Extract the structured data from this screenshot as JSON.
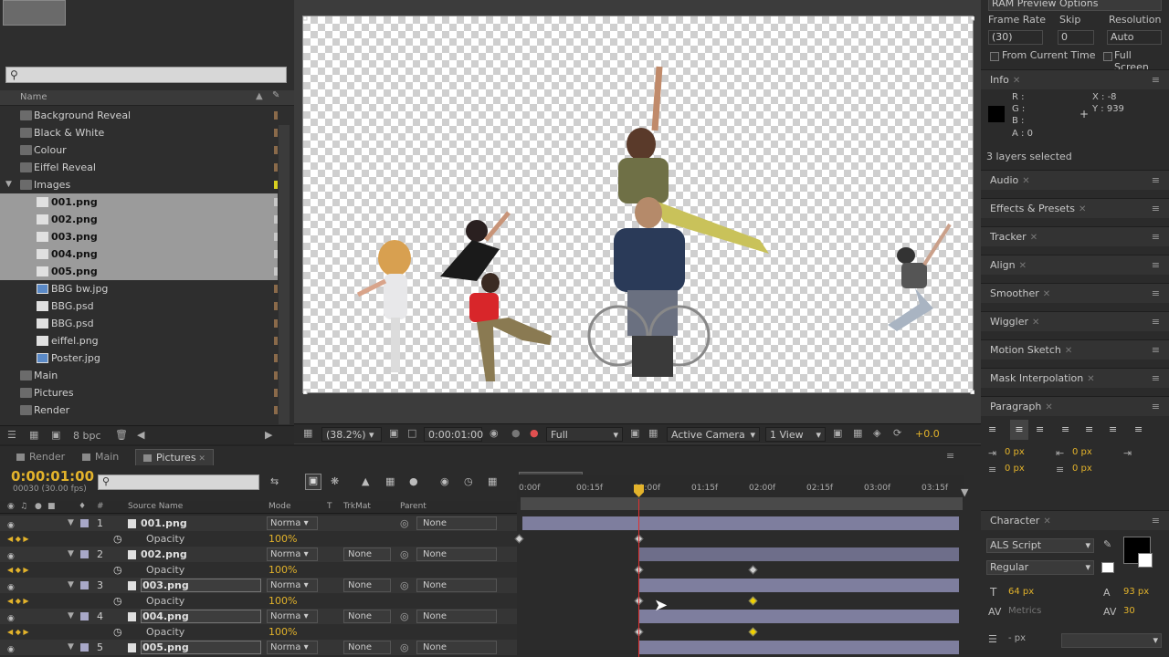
{
  "project": {
    "search_placeholder": "",
    "column_name": "Name",
    "items": [
      {
        "label": "Background Reveal",
        "type": "comp",
        "selected": false,
        "indent": 0
      },
      {
        "label": "Black & White",
        "type": "comp",
        "selected": false,
        "indent": 0
      },
      {
        "label": "Colour",
        "type": "comp",
        "selected": false,
        "indent": 0
      },
      {
        "label": "Eiffel Reveal",
        "type": "comp",
        "selected": false,
        "indent": 0
      },
      {
        "label": "Images",
        "type": "folder",
        "selected": false,
        "indent": 0
      },
      {
        "label": "001.png",
        "type": "file",
        "selected": true,
        "indent": 1
      },
      {
        "label": "002.png",
        "type": "file",
        "selected": true,
        "indent": 1
      },
      {
        "label": "003.png",
        "type": "file",
        "selected": true,
        "indent": 1
      },
      {
        "label": "004.png",
        "type": "file",
        "selected": true,
        "indent": 1
      },
      {
        "label": "005.png",
        "type": "file",
        "selected": true,
        "indent": 1
      },
      {
        "label": "BBG bw.jpg",
        "type": "image",
        "selected": false,
        "indent": 1
      },
      {
        "label": "BBG.psd",
        "type": "file",
        "selected": false,
        "indent": 1
      },
      {
        "label": "BBG.psd",
        "type": "file",
        "selected": false,
        "indent": 1
      },
      {
        "label": "eiffel.png",
        "type": "file",
        "selected": false,
        "indent": 1
      },
      {
        "label": "Poster.jpg",
        "type": "image",
        "selected": false,
        "indent": 1
      },
      {
        "label": "Main",
        "type": "comp",
        "selected": false,
        "indent": 0
      },
      {
        "label": "Pictures",
        "type": "comp",
        "selected": false,
        "indent": 0
      },
      {
        "label": "Render",
        "type": "comp",
        "selected": false,
        "indent": 0
      }
    ],
    "bpc": "8 bpc"
  },
  "viewer": {
    "zoom": "(38.2%)",
    "timecode": "0:00:01:00",
    "resolution": "Full",
    "camera": "Active Camera",
    "views": "1 View",
    "exposure": "+0.0"
  },
  "preview": {
    "title": "RAM Preview Options",
    "frame_rate_label": "Frame Rate",
    "frame_rate_value": "(30)",
    "skip_label": "Skip",
    "skip_value": "0",
    "resolution_label": "Resolution",
    "resolution_value": "Auto",
    "from_current": "From Current Time",
    "full_screen": "Full Screen"
  },
  "info": {
    "title": "Info",
    "r": "R :",
    "g": "G :",
    "b": "B :",
    "a": "A : 0",
    "x": "X : -8",
    "y": "Y : 939",
    "status": "3 layers selected"
  },
  "panels": [
    {
      "label": "Audio"
    },
    {
      "label": "Effects & Presets"
    },
    {
      "label": "Tracker"
    },
    {
      "label": "Align"
    },
    {
      "label": "Smoother"
    },
    {
      "label": "Wiggler"
    },
    {
      "label": "Motion Sketch"
    },
    {
      "label": "Mask Interpolation"
    },
    {
      "label": "Paragraph"
    }
  ],
  "paragraph": {
    "indent1": "0 px",
    "indent2": "0 px",
    "indent3": "0 px",
    "indent4": "0 px"
  },
  "character": {
    "title": "Character",
    "font": "ALS Script",
    "style": "Regular",
    "size": "64 px",
    "leading": "93 px",
    "kerning": "Metrics",
    "tracking": "30",
    "stroke": "- px"
  },
  "timeline": {
    "tabs": [
      {
        "label": "Render",
        "active": false
      },
      {
        "label": "Main",
        "active": false
      },
      {
        "label": "Pictures",
        "active": true
      }
    ],
    "timecode": "0:00:01:00",
    "timecode_sub": "00030 (30.00 fps)",
    "headers": {
      "source": "Source Name",
      "mode": "Mode",
      "t": "T",
      "trkmat": "TrkMat",
      "parent": "Parent"
    },
    "rows": [
      {
        "kind": "layer",
        "num": "1",
        "name": "001.png",
        "mode": "Norma",
        "trkmat": "",
        "parent": "None",
        "boxed": false
      },
      {
        "kind": "sub",
        "prop": "Opacity",
        "value": "100%"
      },
      {
        "kind": "layer",
        "num": "2",
        "name": "002.png",
        "mode": "Norma",
        "trkmat": "None",
        "parent": "None",
        "boxed": false
      },
      {
        "kind": "sub",
        "prop": "Opacity",
        "value": "100%"
      },
      {
        "kind": "layer",
        "num": "3",
        "name": "003.png",
        "mode": "Norma",
        "trkmat": "None",
        "parent": "None",
        "boxed": true
      },
      {
        "kind": "sub",
        "prop": "Opacity",
        "value": "100%"
      },
      {
        "kind": "layer",
        "num": "4",
        "name": "004.png",
        "mode": "Norma",
        "trkmat": "None",
        "parent": "None",
        "boxed": true
      },
      {
        "kind": "sub",
        "prop": "Opacity",
        "value": "100%"
      },
      {
        "kind": "layer",
        "num": "5",
        "name": "005.png",
        "mode": "Norma",
        "trkmat": "None",
        "parent": "None",
        "boxed": true
      }
    ],
    "ruler_ticks": [
      "0:00f",
      "00:15f",
      "01:00f",
      "01:15f",
      "02:00f",
      "02:15f",
      "03:00f",
      "03:15f"
    ]
  },
  "colors": {
    "accent": "#e3b32b",
    "playhead": "#e03030",
    "layer_bar": "#7e7e9e",
    "selected_row": "#9b9b9b"
  }
}
